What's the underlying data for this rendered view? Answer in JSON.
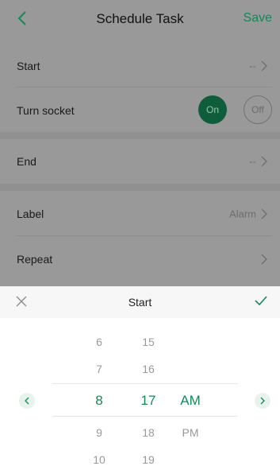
{
  "nav": {
    "title": "Schedule Task",
    "save_label": "Save"
  },
  "rows": {
    "start": {
      "label": "Start",
      "value": "--"
    },
    "turn_socket": {
      "label": "Turn socket",
      "on_label": "On",
      "off_label": "Off"
    },
    "end": {
      "label": "End",
      "value": "--"
    },
    "label": {
      "label": "Label",
      "value": "Alarm"
    },
    "repeat": {
      "label": "Repeat"
    }
  },
  "picker": {
    "title": "Start",
    "hours": [
      "6",
      "7",
      "8",
      "9",
      "10"
    ],
    "minutes": [
      "15",
      "16",
      "17",
      "18",
      "19"
    ],
    "meridiem": [
      "AM",
      "PM"
    ],
    "selected": {
      "hour": "8",
      "minute": "17",
      "meridiem": "AM"
    }
  },
  "colors": {
    "accent": "#128a58",
    "overlay": "#999999"
  },
  "icons": {
    "back": "chevron-left-icon",
    "row_arrow": "chevron-right-icon",
    "close": "close-icon",
    "confirm": "check-icon",
    "prev": "chevron-left-icon",
    "next": "chevron-right-icon"
  }
}
